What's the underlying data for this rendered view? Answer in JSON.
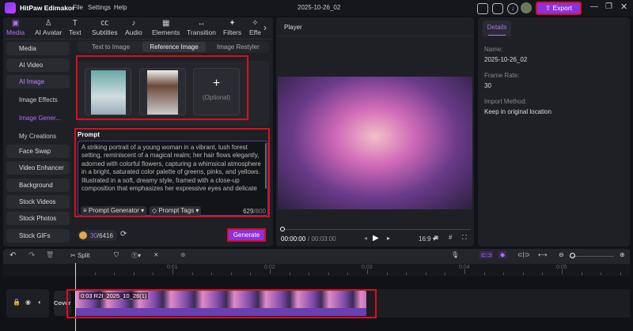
{
  "app": {
    "title": "HitPaw Edimakor",
    "menu": [
      "File",
      "Settings",
      "Help"
    ],
    "project": "2025-10-26_02",
    "export": "Export"
  },
  "toolbar_tabs": [
    {
      "label": "Media",
      "icon": "image-icon",
      "active": true
    },
    {
      "label": "AI Avatar",
      "icon": "avatar-icon"
    },
    {
      "label": "Text",
      "icon": "text-icon"
    },
    {
      "label": "Subtitles",
      "icon": "cc-icon"
    },
    {
      "label": "Audio",
      "icon": "music-note-icon"
    },
    {
      "label": "Elements",
      "icon": "elements-icon"
    },
    {
      "label": "Transition",
      "icon": "transition-icon"
    },
    {
      "label": "Filters",
      "icon": "sparkle-icon"
    },
    {
      "label": "Effe",
      "icon": "effects-icon"
    }
  ],
  "sidebar": {
    "items": [
      "Media",
      "AI Video",
      "AI Image"
    ],
    "sub": [
      "Image Effects",
      "Image Gener...",
      "My Creations"
    ],
    "items2": [
      "Face Swap",
      "Video Enhancer",
      "Background",
      "Stock Videos",
      "Stock Photos",
      "Stock GIFs"
    ]
  },
  "ai_image": {
    "tabs": [
      "Text to Image",
      "Reference Image",
      "Image Restyler"
    ],
    "active_tab": "Reference Image",
    "optional": "(Optional)",
    "prompt_label": "Prompt",
    "prompt": "A striking portrait of a young woman in a vibrant, lush forest setting, reminiscent of a magical realm; her hair flows elegantly, adorned with colorful flowers, capturing a whimsical atmosphere in a bright, saturated color palette of greens, pinks, and yellows. Illustrated in a soft, dreamy style, framed with a close-up composition that emphasizes her expressive eyes and delicate features; the background blurs gently to create depth, enhancing focus on her. Soft ambient lighting filters through the trees, casting dappled",
    "prompt_generator": "Prompt Generator",
    "prompt_tags": "Prompt Tags",
    "count": "629",
    "max": "/800",
    "credits_used": "30",
    "credits_total": "/6416",
    "generate": "Generate"
  },
  "player": {
    "title": "Player",
    "time": "00:00:00",
    "duration": "/ 00:03:00",
    "aspect": "16:9",
    "progress": 0
  },
  "details": {
    "tab": "Details",
    "fields": [
      {
        "label": "Name:",
        "value": "2025-10-26_02"
      },
      {
        "label": "Frame Rate:",
        "value": "30"
      },
      {
        "label": "Import Method:",
        "value": "Keep in original location"
      }
    ]
  },
  "timeline": {
    "split": "Split",
    "ticks": [
      "0:01",
      "0:02",
      "0:03",
      "0:04",
      "0:05"
    ],
    "cover": "Cover",
    "clip": "0:03 R2I_2025_10_26(1)",
    "colors": {
      "accent": "#9b3cf0",
      "clip_bar": "#6a3fb0",
      "highlight": "#d4111e"
    }
  }
}
